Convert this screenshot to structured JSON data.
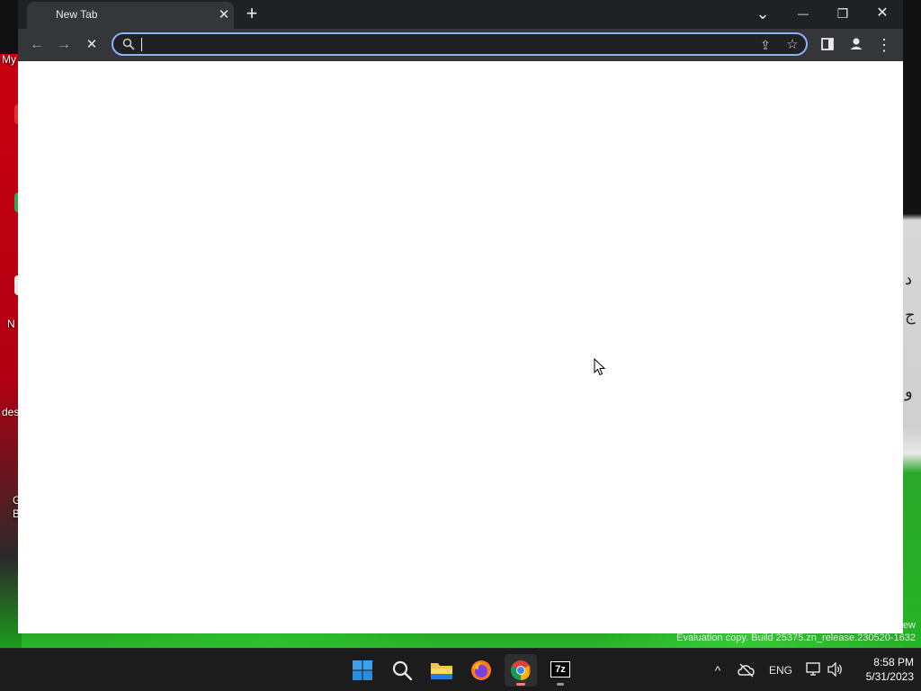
{
  "desktop": {
    "labels": [
      "My",
      "N",
      "des",
      "G",
      "B"
    ],
    "calligraphy": [
      "د",
      "ج",
      "و"
    ]
  },
  "watermark": {
    "line1": "ew",
    "line2": "Evaluation copy. Build 25375.zn_release.230520-1632"
  },
  "browser": {
    "tab": {
      "title": "New Tab",
      "close_glyph": "✕"
    },
    "new_tab_glyph": "+",
    "window_controls": {
      "tab_search": "⌄",
      "minimize": "—",
      "restore": "❐",
      "close": "✕"
    },
    "toolbar": {
      "back_glyph": "←",
      "forward_glyph": "→",
      "stop_glyph": "✕",
      "omnibox": {
        "value": "",
        "placeholder": ""
      },
      "share_glyph": "⇪",
      "bookmark_glyph": "☆",
      "menu_glyph": "⋮"
    }
  },
  "taskbar": {
    "apps": [
      {
        "name": "Start",
        "icon": "windows-start-icon",
        "active": false
      },
      {
        "name": "Search",
        "icon": "search-icon",
        "active": false
      },
      {
        "name": "File Explorer",
        "icon": "folder-icon",
        "active": false
      },
      {
        "name": "Firefox",
        "icon": "firefox-icon",
        "active": false
      },
      {
        "name": "Chrome",
        "icon": "chrome-icon",
        "active": true
      },
      {
        "name": "7-Zip",
        "icon": "7zip-icon",
        "active": false,
        "label": "7z"
      }
    ],
    "tray": {
      "chevron_glyph": "^",
      "language": "ENG",
      "time": "8:58 PM",
      "date": "5/31/2023"
    }
  },
  "colors": {
    "tabstrip": "#202124",
    "toolbar": "#35363a",
    "omnibox_border": "#8ab4f8",
    "taskbar": "#1c1c1c"
  }
}
